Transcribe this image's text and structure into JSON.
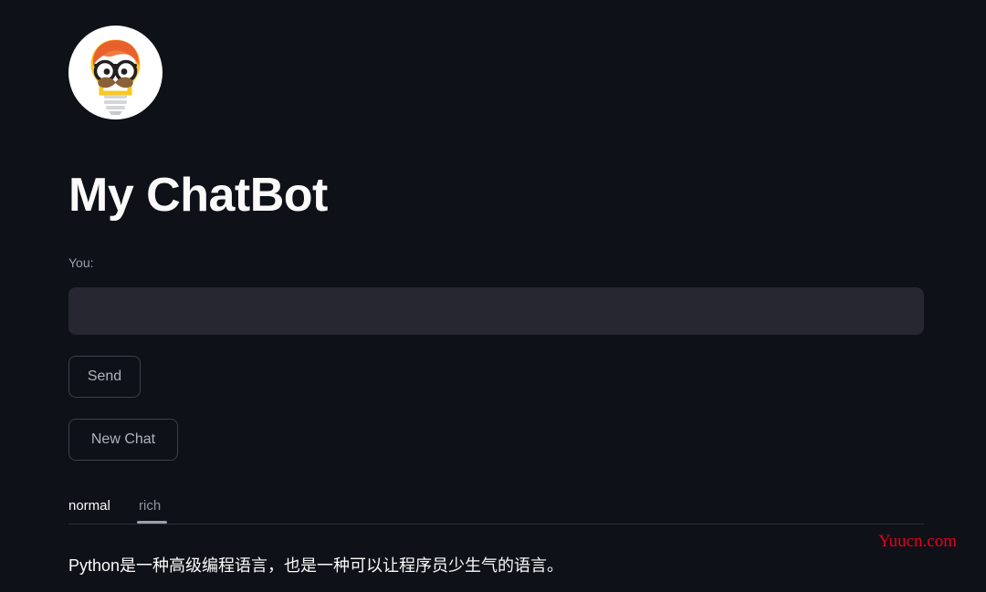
{
  "page": {
    "background_color": "#0e1117",
    "text_color": "#fafafa"
  },
  "logo": {
    "icon": "hipster-lightbulb-avatar-icon",
    "circle_color": "#ffffff",
    "hair_color": "#e8602c",
    "bulb_color": "#f9c823",
    "glasses_color": "#231f20",
    "mustache_color": "#8a6239",
    "base_color": "#d9dadb"
  },
  "header": {
    "title": "My ChatBot"
  },
  "form": {
    "input_label": "You:",
    "input_value": "",
    "input_placeholder": "",
    "send_label": "Send",
    "new_chat_label": "New Chat"
  },
  "tabs": {
    "items": [
      {
        "label": "normal",
        "selected": false
      },
      {
        "label": "rich",
        "selected": true
      }
    ],
    "active_indicator_color": "#9aa0ab"
  },
  "response": {
    "text": "Python是一种高级编程语言，也是一种可以让程序员少生气的语言。"
  },
  "watermark": {
    "text": "Yuucn.com",
    "color": "#e8001c"
  }
}
